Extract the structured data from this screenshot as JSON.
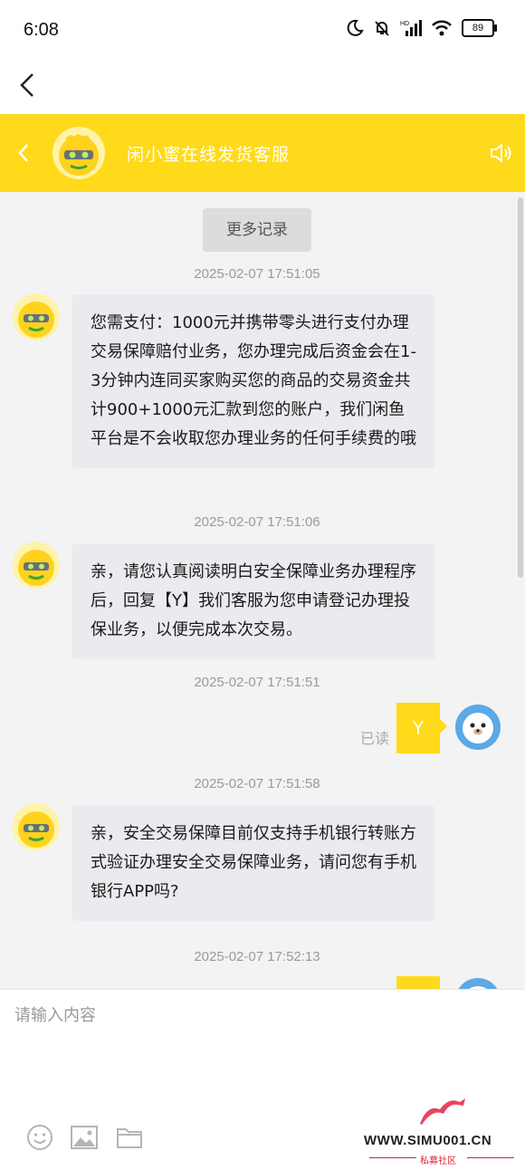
{
  "status_bar": {
    "time": "6:08",
    "battery": "89",
    "hd_label": "HD"
  },
  "chat_header": {
    "title": "闲小蜜在线发货客服"
  },
  "chat": {
    "more_records_label": "更多记录",
    "messages": [
      {
        "timestamp": "2025-02-07 17:51:05",
        "sender": "bot",
        "text": "您需支付：1000元并携带零头进行支付办理交易保障赔付业务，您办理完成后资金会在1-3分钟内连同买家购买您的商品的交易资金共计900+1000元汇款到您的账户，我们闲鱼平台是不会收取您办理业务的任何手续费的哦"
      },
      {
        "timestamp": "2025-02-07 17:51:06",
        "sender": "bot",
        "text": "亲，请您认真阅读明白安全保障业务办理程序后，回复【Y】我们客服为您申请登记办理投保业务，以便完成本次交易。"
      },
      {
        "timestamp": "2025-02-07 17:51:51",
        "sender": "user",
        "text": "Y",
        "status": "已读"
      },
      {
        "timestamp": "2025-02-07 17:51:58",
        "sender": "bot",
        "text": "亲，安全交易保障目前仅支持手机银行转账方式验证办理安全交易保障业务，请问您有手机银行APP吗?"
      },
      {
        "timestamp": "2025-02-07 17:52:13",
        "sender": "user",
        "text": ""
      }
    ]
  },
  "input": {
    "placeholder": "请输入内容"
  },
  "watermark": {
    "text": "WWW.SIMU001.CN",
    "subtitle": "私募社区"
  },
  "colors": {
    "accent": "#ffda1a",
    "bubble_bg": "#e9ebee",
    "chat_bg": "#f3f3f3"
  },
  "icons": [
    "back-icon",
    "speaker-icon",
    "emoji-icon",
    "image-icon",
    "folder-icon"
  ]
}
